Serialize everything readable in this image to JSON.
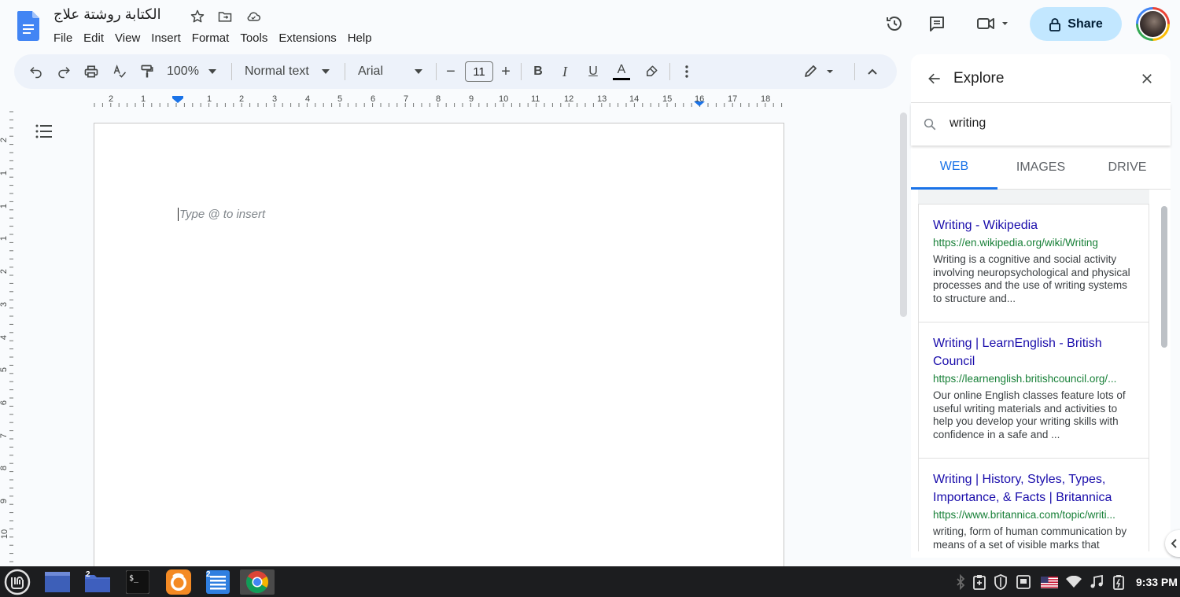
{
  "document": {
    "title": "الكتابة روشتة علاج",
    "placeholder": "Type @ to insert"
  },
  "menu": {
    "items": [
      "File",
      "Edit",
      "View",
      "Insert",
      "Format",
      "Tools",
      "Extensions",
      "Help"
    ]
  },
  "header": {
    "share_label": "Share"
  },
  "toolbar": {
    "zoom": "100%",
    "style": "Normal text",
    "font": "Arial",
    "font_size": "11",
    "minus": "−",
    "plus": "+",
    "bold": "B",
    "italic": "I",
    "underline": "U",
    "text_color": "A"
  },
  "ruler": {
    "horizontal_labels": [
      "2",
      "1",
      "1",
      "2",
      "3",
      "4",
      "5",
      "6",
      "7",
      "8",
      "9",
      "10",
      "11",
      "12",
      "13",
      "14",
      "15",
      "16",
      "17",
      "18"
    ],
    "vertical_labels": [
      "2",
      "1",
      "1",
      "1",
      "2",
      "3",
      "4",
      "5",
      "6",
      "7",
      "8",
      "9",
      "10"
    ]
  },
  "explore": {
    "title": "Explore",
    "search_value": "writing",
    "tabs": [
      "WEB",
      "IMAGES",
      "DRIVE"
    ],
    "active_tab": "WEB",
    "results": [
      {
        "title": "Writing - Wikipedia",
        "url": "https://en.wikipedia.org/wiki/Writing",
        "snippet": "Writing is a cognitive and social activity involving neuropsychological and physical processes and the use of writing systems to structure and..."
      },
      {
        "title": "Writing | LearnEnglish - British Council",
        "url": "https://learnenglish.britishcouncil.org/...",
        "snippet": "Our online English classes feature lots of useful writing materials and activities to help you develop your writing skills with confidence in a safe and ..."
      },
      {
        "title": "Writing | History, Styles, Types, Importance, & Facts | Britannica",
        "url": "https://www.britannica.com/topic/writi...",
        "snippet": "writing, form of human communication by means of a set of visible marks that"
      }
    ]
  },
  "taskbar": {
    "badge_files": "2",
    "badge_docs": "2",
    "terminal_glyph": "$_",
    "clock": "9:33 PM"
  },
  "colors": {
    "accent": "#1a73e8",
    "share_bg": "#c2e7ff",
    "link": "#1a0dab",
    "url": "#188038",
    "taskbar": "#1c1d1f"
  }
}
